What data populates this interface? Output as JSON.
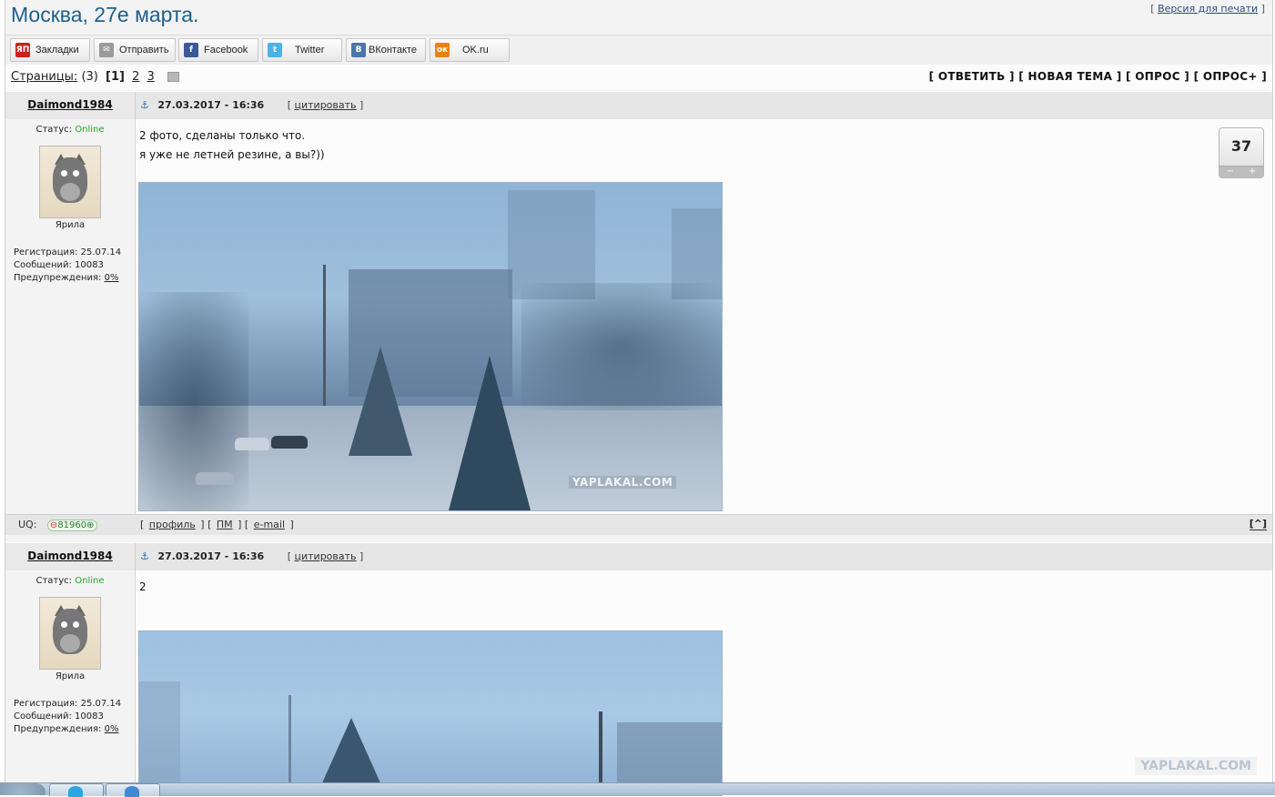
{
  "header": {
    "title": "Москва, 27е марта.",
    "print_link": {
      "prefix": "[",
      "label": "Версия для печати",
      "suffix": "]"
    }
  },
  "share": [
    {
      "name": "zakladki",
      "label": "Закладки",
      "icon": "yandex-bookmarks-icon",
      "icon_text": "ЯП",
      "color": "#cc1f1f"
    },
    {
      "name": "otpravit",
      "label": "Отправить",
      "icon": "envelope-icon",
      "icon_text": "✉",
      "color": "#8a8a8a"
    },
    {
      "name": "facebook",
      "label": "Facebook",
      "icon": "facebook-icon",
      "icon_text": "f",
      "color": "#3b5998"
    },
    {
      "name": "twitter",
      "label": "Twitter",
      "icon": "twitter-icon",
      "icon_text": "t",
      "color": "#4ab3e8"
    },
    {
      "name": "vkontakte",
      "label": "ВКонтакте",
      "icon": "vk-icon",
      "icon_text": "В",
      "color": "#4a76a8"
    },
    {
      "name": "okru",
      "label": "OK.ru",
      "icon": "odnoklassniki-icon",
      "icon_text": "ок",
      "color": "#ee8208"
    }
  ],
  "pagination": {
    "label": "Страницы:",
    "count": "(3)",
    "current": "[1]",
    "pages": [
      "2",
      "3"
    ]
  },
  "actions": {
    "reply": "[ ОТВЕТИТЬ ]",
    "new_topic": "[ НОВАЯ ТЕМА ]",
    "poll": "[ ОПРОС ]",
    "poll_plus": "[ ОПРОС+ ]"
  },
  "posts": [
    {
      "author": "Daimond1984",
      "status_label": "Статус:",
      "status_value": "Online",
      "rank": "Ярила",
      "reg": "Регистрация: 25.07.14",
      "messages": "Сообщений: 10083",
      "warnings_label": "Предупреждения:",
      "warnings_value": "0%",
      "date": "27.03.2017 - 16:36",
      "quote_label": "цитировать",
      "text_lines": [
        "2 фото, сделаны только что.",
        "я уже не летней резине, а вы?))"
      ],
      "rating": "37",
      "rating_minus": "−",
      "rating_plus": "+",
      "watermark": "YAPLAKAL.COM",
      "footer": {
        "uq_label": "UQ:",
        "uq_value": "81960",
        "profile": "профиль",
        "pm": "ПМ",
        "email": "e-mail",
        "top": "[^]"
      }
    },
    {
      "author": "Daimond1984",
      "status_label": "Статус:",
      "status_value": "Online",
      "rank": "Ярила",
      "reg": "Регистрация: 25.07.14",
      "messages": "Сообщений: 10083",
      "warnings_label": "Предупреждения:",
      "warnings_value": "0%",
      "date": "27.03.2017 - 16:36",
      "quote_label": "цитировать",
      "text_lines": [
        "2"
      ]
    }
  ],
  "page_watermark": "YAPLAKAL.COM",
  "colors": {
    "title": "#1d5f8c",
    "online": "#2ca02c",
    "frame_bg": "#f3f3f3"
  }
}
